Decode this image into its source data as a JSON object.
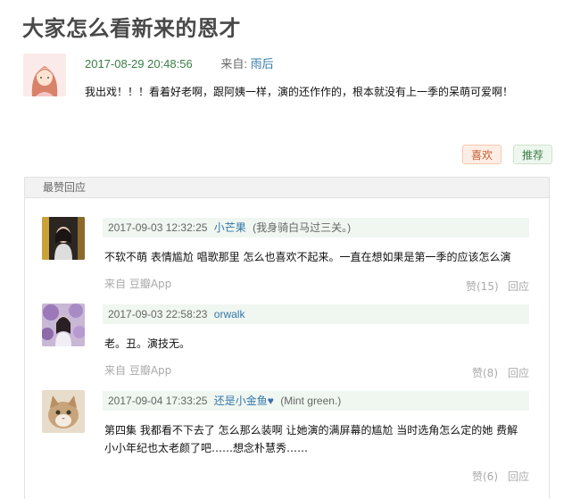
{
  "post": {
    "title": "大家怎么看新来的恩才",
    "time": "2017-08-29 20:48:56",
    "from_label": "来自:",
    "author": "雨后",
    "body": "我出戏！！！看着好老啊，跟阿姨一样，演的还作作的，根本就没有上一季的呆萌可爱啊！",
    "like_label": "喜欢",
    "recommend_label": "推荐"
  },
  "section": {
    "title": "最赞回应"
  },
  "comments": [
    {
      "time": "2017-09-03 12:32:25",
      "user": "小芒果",
      "signature": "(我身骑白马过三关。)",
      "text": "不软不萌 表情尴尬 唱歌那里 怎么也喜欢不起来。一直在想如果是第一季的应该怎么演",
      "source": "来自 豆瓣App",
      "votes": "赞(15)",
      "reply": "回应"
    },
    {
      "time": "2017-09-03 22:58:23",
      "user": "orwalk",
      "signature": "",
      "text": "老。丑。演技无。",
      "source": "来自 豆瓣App",
      "votes": "赞(8)",
      "reply": "回应"
    },
    {
      "time": "2017-09-04 17:33:25",
      "user": "还是小金鱼",
      "heart": "♥",
      "signature": "(Mint green.)",
      "text": "第四集 我都看不下去了 怎么那么装啊 让她演的满屏幕的尴尬 当时选角怎么定的她 费解 小小年纪也太老颜了吧……想念朴慧秀……",
      "source": "",
      "votes": "赞(6)",
      "reply": "回应"
    }
  ]
}
